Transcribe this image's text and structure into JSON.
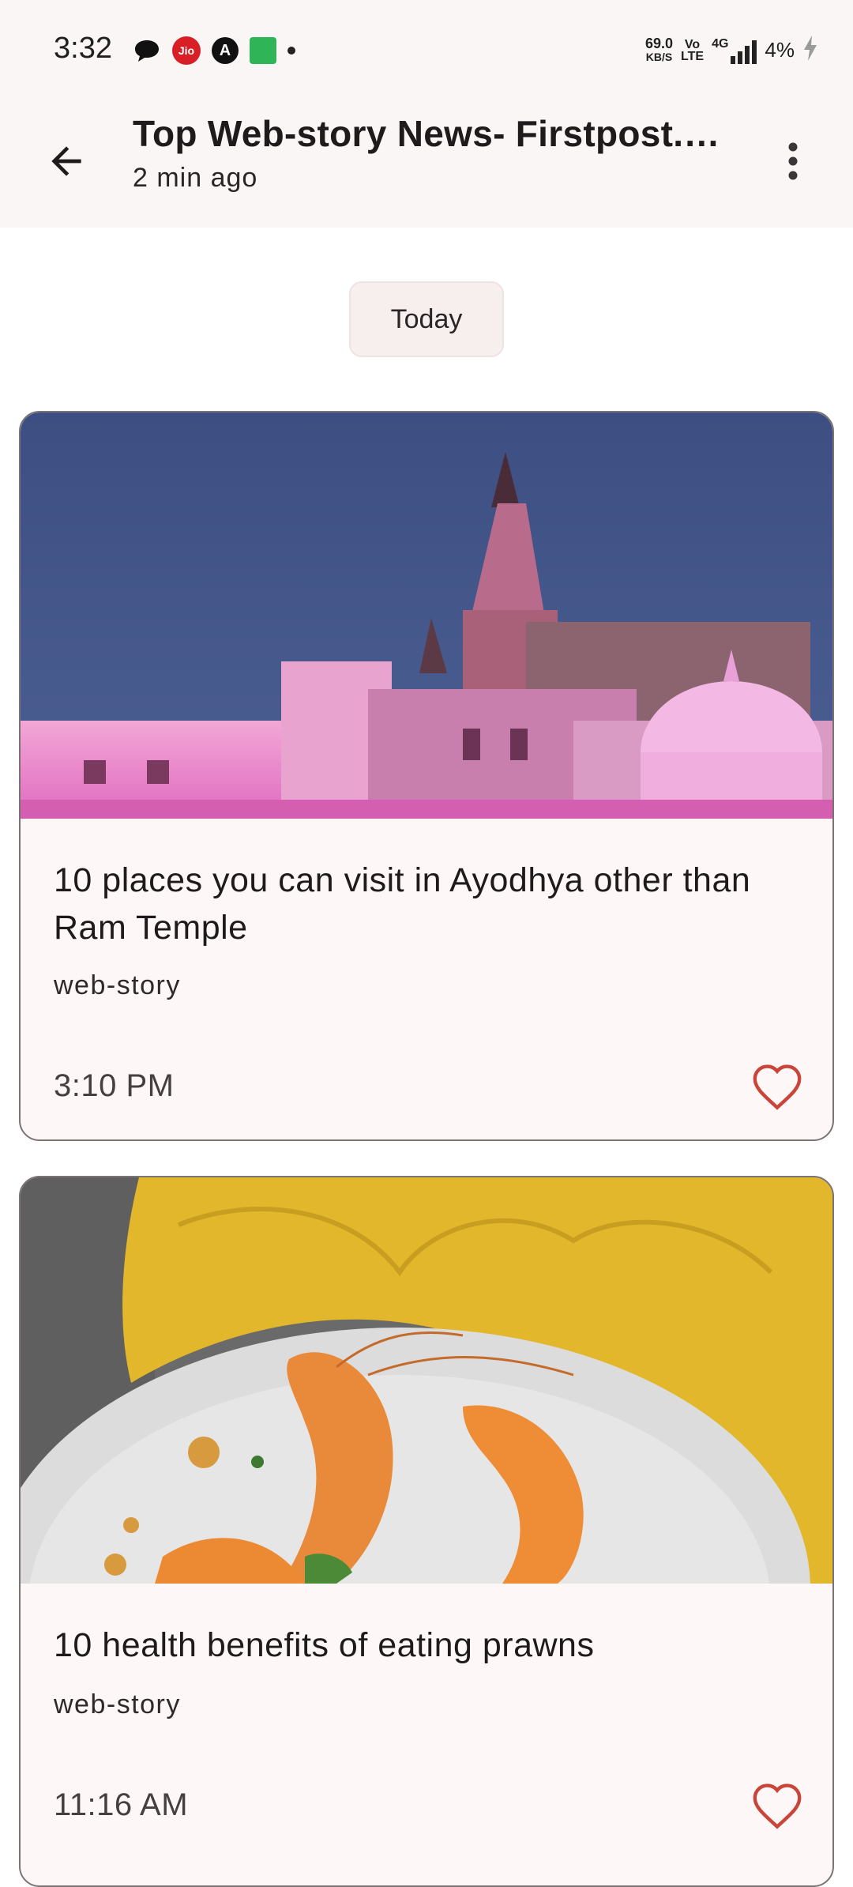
{
  "status_bar": {
    "time": "3:32",
    "net_speed_value": "69.0",
    "net_speed_unit": "KB/S",
    "volte_top": "Vo",
    "volte_bottom": "LTE",
    "network_type": "4G",
    "battery": "4%",
    "icons": [
      "chat-bubble-icon",
      "jio-icon",
      "a-circle-icon",
      "green-app-icon",
      "dot-icon",
      "signal-icon",
      "charging-icon"
    ]
  },
  "app_bar": {
    "title": "Top Web-story News- Firstpost.…",
    "subtitle": "2 min ago",
    "back_icon": "arrow-left-icon",
    "more_icon": "more-vert-icon"
  },
  "date_chip": {
    "label": "Today"
  },
  "articles": [
    {
      "title": "10 places you can visit in Ayodhya other than Ram Temple",
      "category": "web-story",
      "time": "3:10 PM",
      "image": "ayodhya-temple-photo",
      "favorite_icon": "heart-outline-icon"
    },
    {
      "title": "10 health benefits of eating prawns",
      "category": "web-story",
      "time": "11:16 AM",
      "image": "prawns-plate-photo",
      "favorite_icon": "heart-outline-icon"
    }
  ],
  "colors": {
    "surface": "#faf6f5",
    "card_border": "#7c7374",
    "heart": "#c9453a"
  }
}
